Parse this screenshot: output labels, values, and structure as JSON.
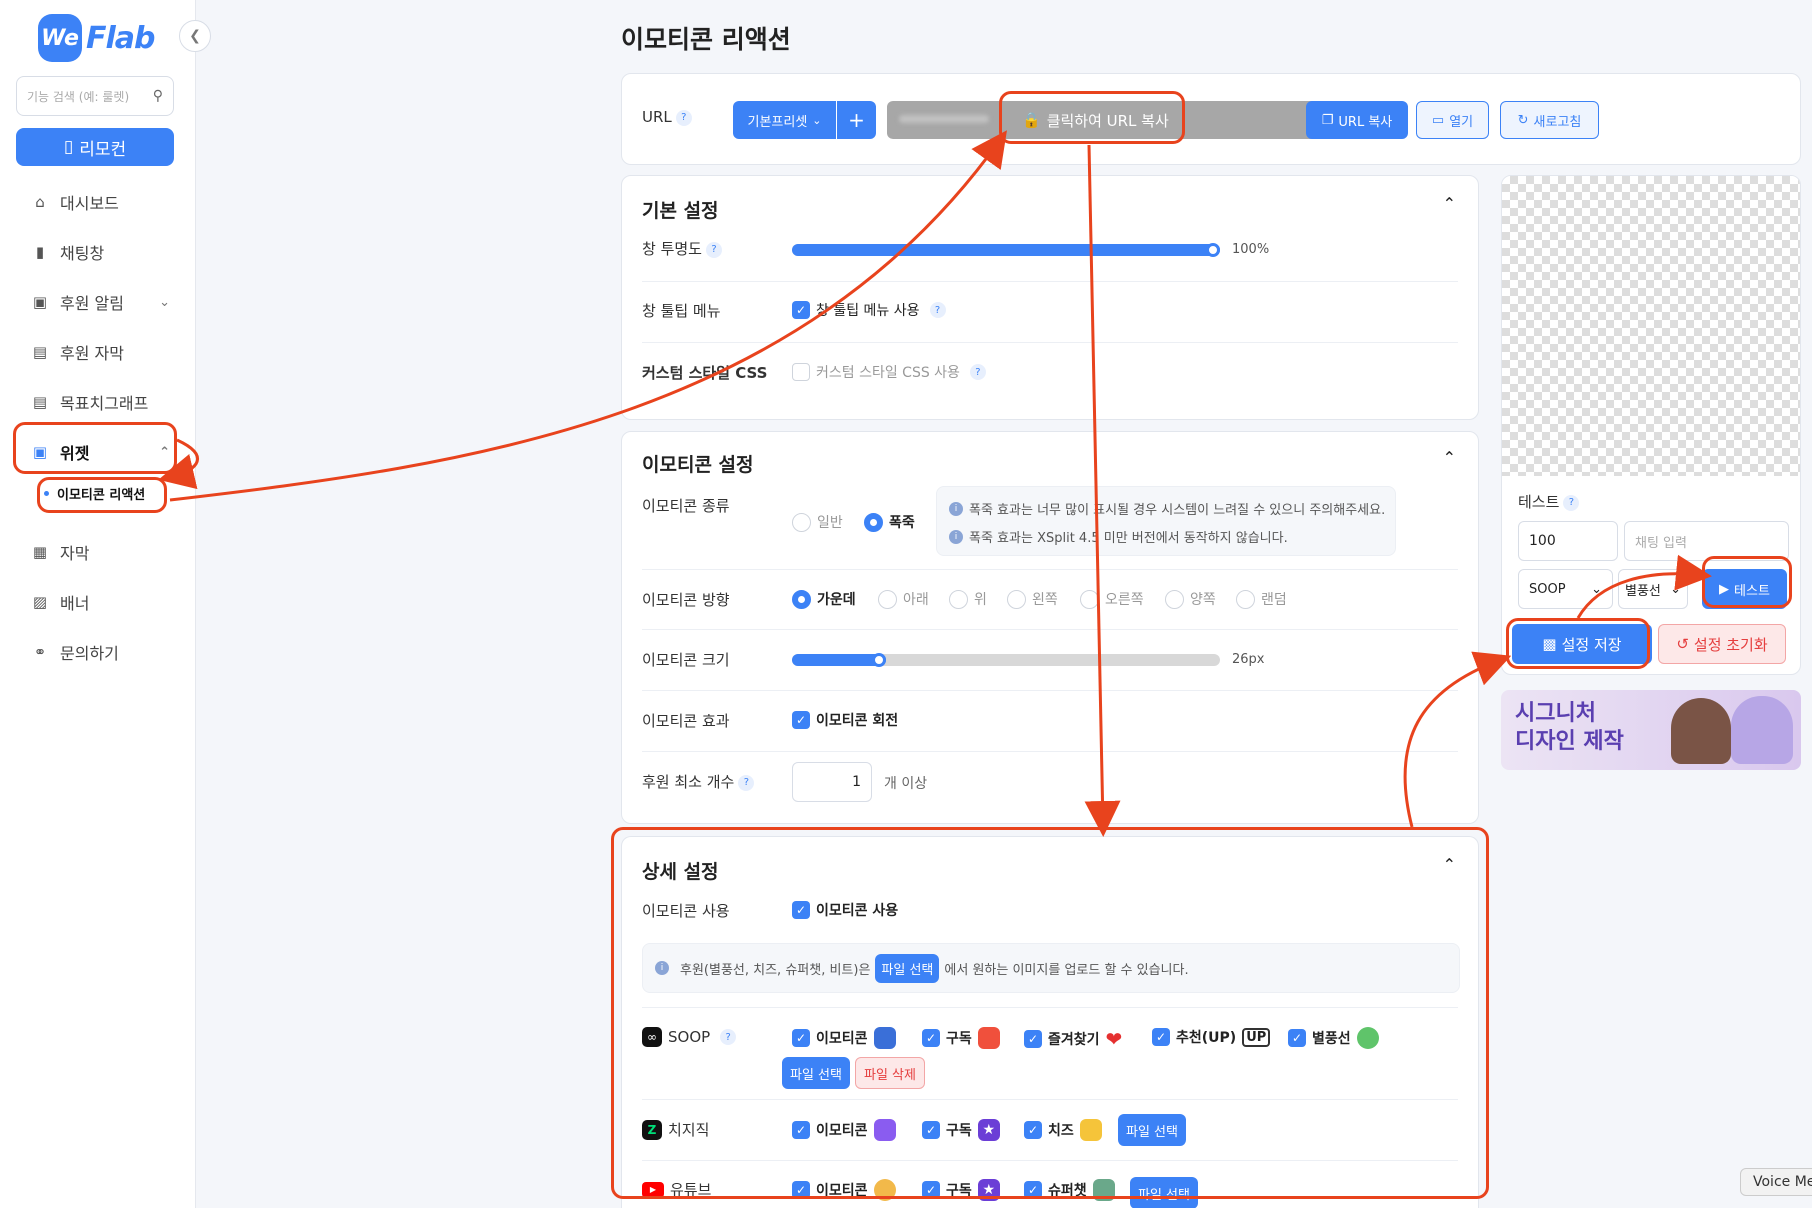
{
  "sidebar": {
    "logo_we": "We",
    "logo_flab": "Flab",
    "search_placeholder": "기능 검색 (예: 룰렛)",
    "remote_label": "리모컨",
    "items": [
      {
        "label": "대시보드",
        "icon": "home-icon"
      },
      {
        "label": "채팅창",
        "icon": "chat-icon"
      },
      {
        "label": "후원 알림",
        "icon": "gift-icon"
      },
      {
        "label": "후원 자막",
        "icon": "caption-icon"
      },
      {
        "label": "목표치그래프",
        "icon": "graph-icon"
      },
      {
        "label": "위젯",
        "icon": "widget-icon"
      },
      {
        "label": "자막",
        "icon": "subtitle-icon"
      },
      {
        "label": "배너",
        "icon": "banner-icon"
      },
      {
        "label": "문의하기",
        "icon": "headset-icon"
      }
    ],
    "sub_item": "이모티콘 리액션"
  },
  "page_title": "이모티콘 리액션",
  "url_bar": {
    "label": "URL",
    "preset": "기본프리셋",
    "copy_overlay": "클릭하여 URL 복사",
    "copy_button": "URL 복사",
    "open_button": "열기",
    "refresh_button": "새로고침"
  },
  "basic": {
    "title": "기본 설정",
    "opacity_label": "창 투명도",
    "opacity_value": "100%",
    "opacity_fraction": 1.0,
    "tooltip_label": "창 툴팁 메뉴",
    "tooltip_option": "창 툴팁 메뉴 사용",
    "css_label": "커스텀 스타일 CSS",
    "css_option": "커스텀 스타일 CSS 사용"
  },
  "emoticon": {
    "title": "이모티콘 설정",
    "type_label": "이모티콘 종류",
    "type_options": [
      "일반",
      "폭죽"
    ],
    "info_lines": [
      "폭죽 효과는 너무 많이 표시될 경우 시스템이 느려질 수 있으니 주의해주세요.",
      "폭죽 효과는 XSplit 4.5 미만 버전에서 동작하지 않습니다."
    ],
    "direction_label": "이모티콘 방향",
    "direction_options": [
      "가운데",
      "아래",
      "위",
      "왼쪽",
      "오른쪽",
      "양쪽",
      "랜덤"
    ],
    "size_label": "이모티콘 크기",
    "size_value": "26px",
    "size_fraction": 0.22,
    "effect_label": "이모티콘 효과",
    "effect_option": "이모티콘 회전",
    "min_label": "후원 최소 개수",
    "min_value": "1",
    "min_suffix": "개 이상"
  },
  "detail": {
    "title": "상세 설정",
    "use_label": "이모티콘 사용",
    "use_option": "이모티콘 사용",
    "info_prefix": "후원(별풍선, 치즈, 슈퍼챗, 비트)은",
    "info_tag": "파일 선택",
    "info_suffix": "에서 원하는 이미지를 업로드 할 수 있습니다.",
    "file_select": "파일 선택",
    "file_delete": "파일 삭제",
    "platforms": [
      {
        "name": "SOOP",
        "options": [
          "이모티콘",
          "구독",
          "즐겨찾기",
          "추천(UP)",
          "별풍선"
        ]
      },
      {
        "name": "치지직",
        "options": [
          "이모티콘",
          "구독",
          "치즈"
        ]
      },
      {
        "name": "유튜브",
        "options": [
          "이모티콘",
          "구독",
          "슈퍼챗"
        ]
      }
    ]
  },
  "test_panel": {
    "title": "테스트",
    "amount": "100",
    "chat_placeholder": "채팅 입력",
    "platform": "SOOP",
    "type": "별풍선",
    "test_button": "테스트",
    "save_button": "설정 저장",
    "reset_button": "설정 초기화"
  },
  "banner": {
    "line1": "시그니처",
    "line2": "디자인 제작"
  },
  "voice_label": "Voice Me",
  "colors": {
    "accent": "#3c82f6",
    "annotation": "#e8431d",
    "danger": "#e53e3e"
  }
}
